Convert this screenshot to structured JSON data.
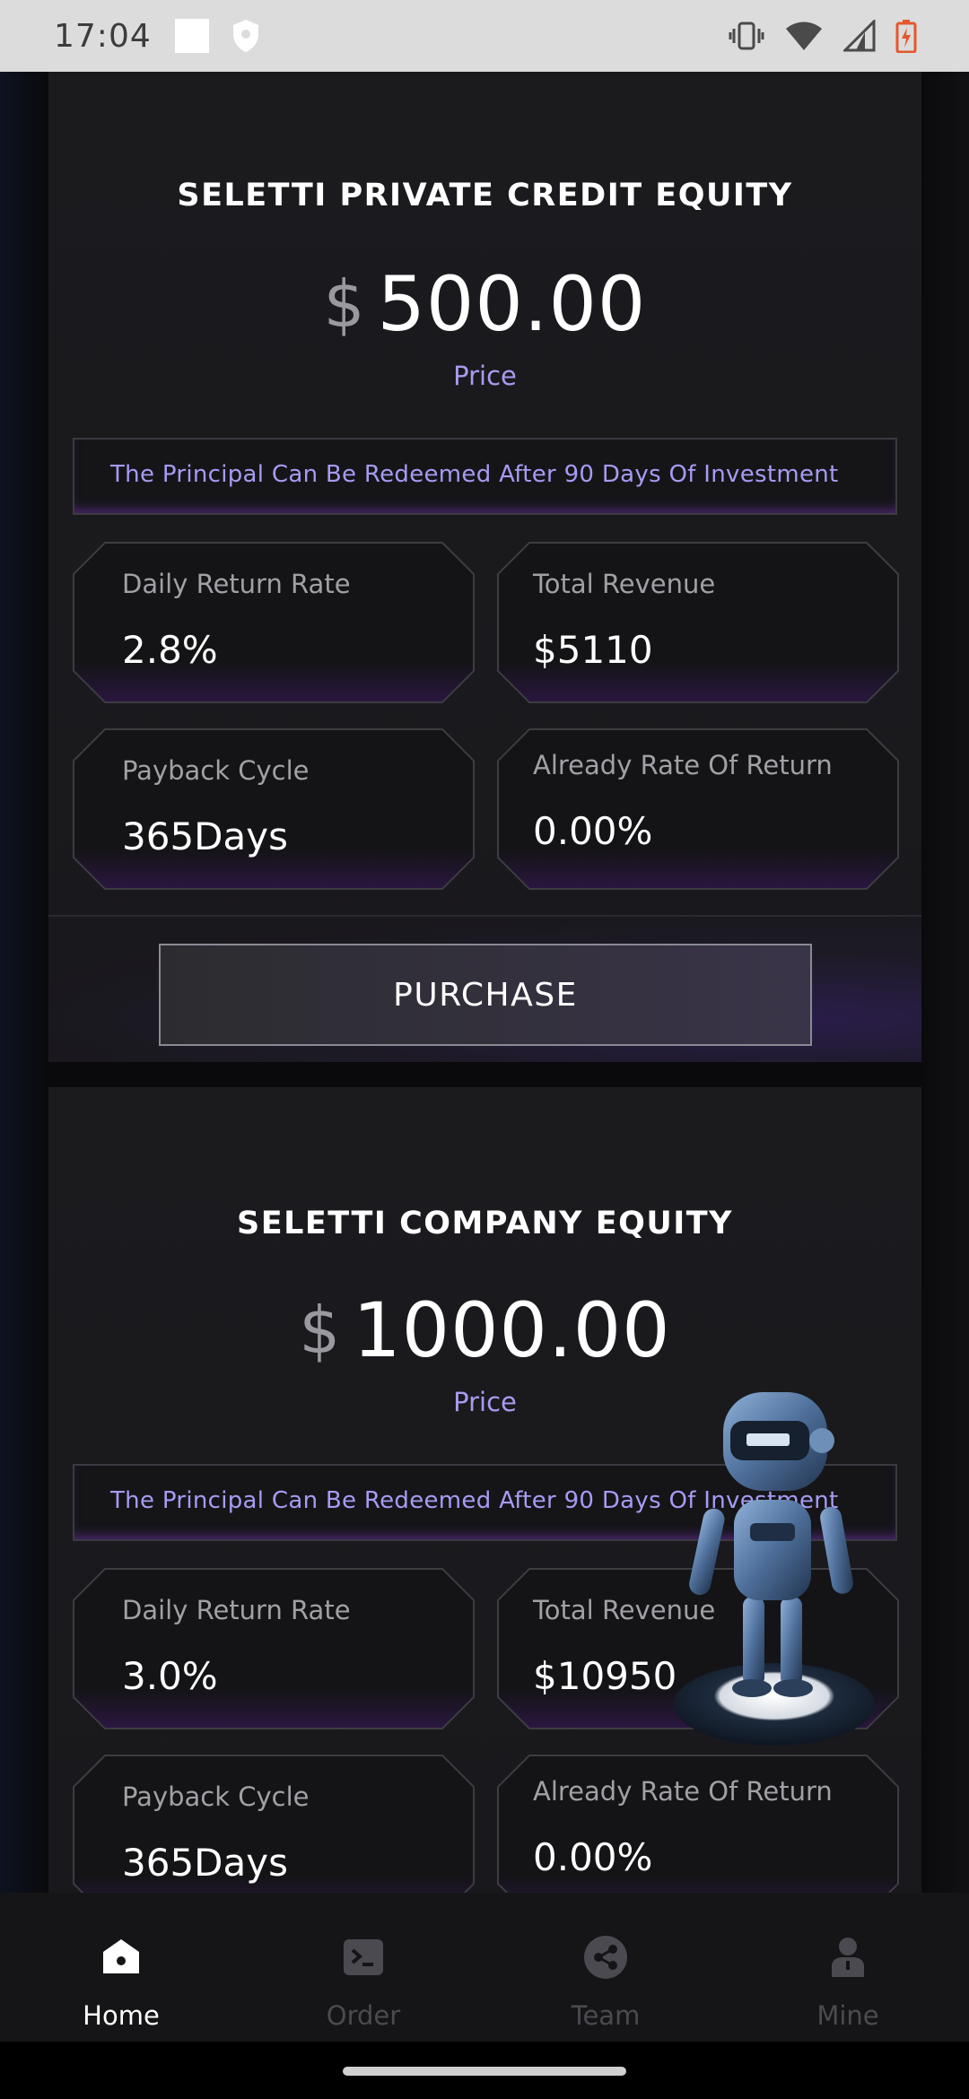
{
  "status_bar": {
    "time": "17:04"
  },
  "products": [
    {
      "title": "SELETTI PRIVATE CREDIT EQUITY",
      "currency": "$",
      "price": "500.00",
      "price_label": "Price",
      "note": "The Principal Can Be Redeemed After 90 Days Of Investment",
      "stats": [
        {
          "label": "Daily Return Rate",
          "value": "2.8%"
        },
        {
          "label": "Total Revenue",
          "value": "$5110"
        },
        {
          "label": "Payback Cycle",
          "value": "365Days"
        },
        {
          "label": "Already Rate Of Return",
          "value": "0.00%"
        }
      ],
      "button": "PURCHASE"
    },
    {
      "title": "SELETTI COMPANY EQUITY",
      "currency": "$",
      "price": "1000.00",
      "price_label": "Price",
      "note": "The Principal Can Be Redeemed After 90 Days Of Investment",
      "stats": [
        {
          "label": "Daily Return Rate",
          "value": "3.0%"
        },
        {
          "label": "Total Revenue",
          "value": "$10950"
        },
        {
          "label": "Payback Cycle",
          "value": "365Days"
        },
        {
          "label": "Already Rate Of Return",
          "value": "0.00%"
        }
      ]
    }
  ],
  "bottom_nav": {
    "items": [
      {
        "label": "Home",
        "icon": "home-icon",
        "active": true
      },
      {
        "label": "Order",
        "icon": "terminal-icon",
        "active": false
      },
      {
        "label": "Team",
        "icon": "share-icon",
        "active": false
      },
      {
        "label": "Mine",
        "icon": "user-icon",
        "active": false
      }
    ]
  },
  "colors": {
    "accent": "#a99bf0",
    "glow": "#9b3ce6",
    "card_bg": "#1b1b1e",
    "nav_inactive": "#4a4a50"
  }
}
